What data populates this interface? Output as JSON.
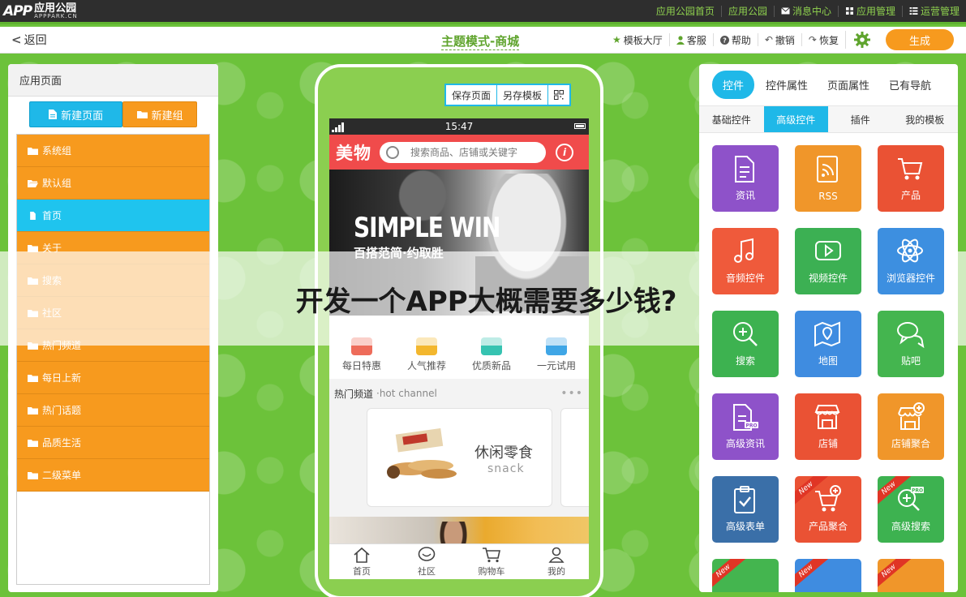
{
  "topbar": {
    "logo_mark": "APP",
    "logo_cn": "应用公园",
    "logo_en": "APPPARK.CN",
    "nav": [
      "应用公园首页",
      "应用公园",
      "消息中心",
      "应用管理",
      "运营管理"
    ]
  },
  "toolbar": {
    "back": "返回",
    "mode_title": "主题模式-商城",
    "tools": [
      "模板大厅",
      "客服",
      "帮助",
      "撤销",
      "恢复"
    ],
    "generate": "生成"
  },
  "left": {
    "title": "应用页面",
    "new_page": "新建页面",
    "new_group": "新建组",
    "items": [
      "系统组",
      "默认组",
      "首页",
      "关于",
      "搜索",
      "社区",
      "热门频道",
      "每日上新",
      "热门话题",
      "品质生活",
      "二级菜单"
    ],
    "active_index": 2
  },
  "phone": {
    "actions": [
      "保存页面",
      "另存模板"
    ],
    "status_time": "15:47",
    "brand": "美物",
    "search_placeholder": "搜索商品、店铺或关键字",
    "banner_title": "SIMPLE WIN",
    "banner_sub_cn": "百搭范简·约取胜",
    "quick": [
      "每日特惠",
      "人气推荐",
      "优质新品",
      "一元试用"
    ],
    "hot_title": "热门频道",
    "hot_en": "·hot channel",
    "hot_card_cn": "休闲零食",
    "hot_card_en": "snack",
    "tabs": [
      "首页",
      "社区",
      "购物车",
      "我的"
    ]
  },
  "overlay": {
    "text": "开发一个APP大概需要多少钱?"
  },
  "right": {
    "tabs": [
      "控件",
      "控件属性",
      "页面属性",
      "已有导航"
    ],
    "active_tab": 0,
    "subtabs": [
      "基础控件",
      "高级控件",
      "插件",
      "我的模板"
    ],
    "active_subtab": 1,
    "ribbon": "New",
    "tiles": [
      {
        "label": "资讯",
        "color": "#8e52c9",
        "icon": "document-icon"
      },
      {
        "label": "RSS",
        "color": "#f0962a",
        "icon": "rss-icon"
      },
      {
        "label": "产品",
        "color": "#ea5234",
        "icon": "cart-icon"
      },
      {
        "label": "音频控件",
        "color": "#ef5a3b",
        "icon": "music-icon"
      },
      {
        "label": "视频控件",
        "color": "#3cb053",
        "icon": "video-icon"
      },
      {
        "label": "浏览器控件",
        "color": "#3d8fe0",
        "icon": "atom-icon"
      },
      {
        "label": "搜索",
        "color": "#3db250",
        "icon": "search-icon"
      },
      {
        "label": "地图",
        "color": "#3f8ce0",
        "icon": "map-icon"
      },
      {
        "label": "贴吧",
        "color": "#44b54f",
        "icon": "chat-icon"
      },
      {
        "label": "高级资讯",
        "color": "#8e52c9",
        "icon": "pro-doc-icon"
      },
      {
        "label": "店铺",
        "color": "#ea5234",
        "icon": "store-icon"
      },
      {
        "label": "店铺聚合",
        "color": "#f0962a",
        "icon": "store-plus-icon"
      },
      {
        "label": "高级表单",
        "color": "#3a6fa8",
        "icon": "clipboard-icon"
      },
      {
        "label": "产品聚合",
        "color": "#ea5234",
        "icon": "cart-plus-icon"
      },
      {
        "label": "高级搜索",
        "color": "#3db250",
        "icon": "pro-search-icon"
      }
    ]
  }
}
